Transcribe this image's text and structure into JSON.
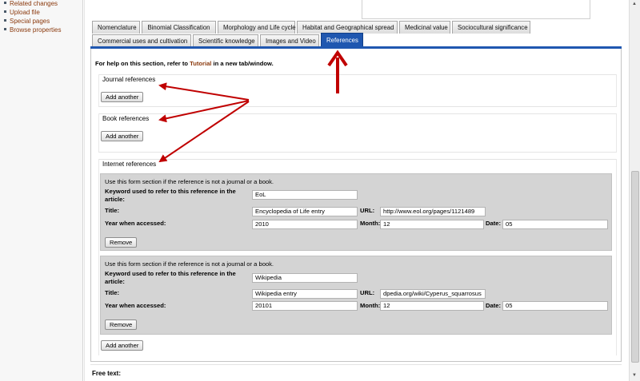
{
  "sidebar": {
    "links": [
      "Related changes",
      "Upload file",
      "Special pages",
      "Browse properties"
    ]
  },
  "tabs": {
    "row1": [
      "Nomenclature",
      "Binomial Classification",
      "Morphology and Life cycle",
      "Habitat and Geographical spread",
      "Medicinal value",
      "Sociocultural significance"
    ],
    "row2": [
      "Commercial uses and cultivation",
      "Scientific knowledge",
      "Images and Video",
      "References"
    ],
    "active": "References"
  },
  "help": {
    "prefix": "For help on this section, refer to ",
    "link": "Tutorial",
    "suffix": " in a new tab/window."
  },
  "sections": {
    "journal": {
      "title": "Journal references",
      "button": "Add another"
    },
    "book": {
      "title": "Book references",
      "button": "Add another"
    },
    "internet": {
      "title": "Internet references",
      "button": "Add another"
    }
  },
  "internet_refs": [
    {
      "note": "Use this form section if the reference is not a journal or a book.",
      "keyword_label_1": "Keyword used to refer to this reference in the",
      "keyword_label_2": "article:",
      "keyword": "EoL",
      "title_label": "Title:",
      "title": "Encyclopedia of Life entry",
      "url_label": "URL:",
      "url": "http://www.eol.org/pages/1121489",
      "year_label": "Year when accessed:",
      "year": "2010",
      "month_label": "Month:",
      "month": "12",
      "date_label": "Date:",
      "date": "05",
      "remove": "Remove"
    },
    {
      "note": "Use this form section if the reference is not a journal or a book.",
      "keyword_label_1": "Keyword used to refer to this reference in the",
      "keyword_label_2": "article:",
      "keyword": "Wikipedia",
      "title_label": "Title:",
      "title": "Wikipedia entry",
      "url_label": "URL:",
      "url": "dpedia.org/wiki/Cyperus_squarrosus",
      "year_label": "Year when accessed:",
      "year": "20101",
      "month_label": "Month:",
      "month": "12",
      "date_label": "Date:",
      "date": "05",
      "remove": "Remove"
    }
  ],
  "free_text_label": "Free text:",
  "colors": {
    "active_tab": "#1f57b0",
    "annotation_arrow": "#c00000",
    "link": "#8b3a0e"
  },
  "icons": [
    "bullet-icon",
    "annotation-arrow-icon",
    "scroll-up-icon",
    "scroll-down-icon"
  ]
}
